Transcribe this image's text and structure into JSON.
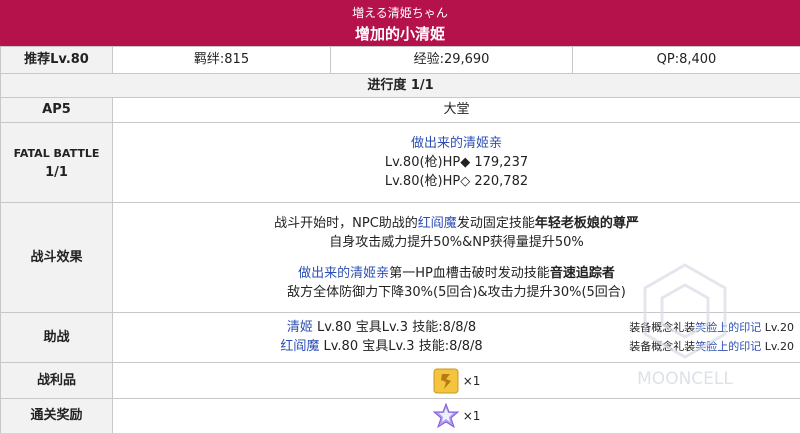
{
  "header": {
    "jp_title": "増える清姫ちゃん",
    "cn_title": "增加的小清姫"
  },
  "stats": {
    "recommend": "推荐Lv.80",
    "bond": "羁绊:815",
    "exp": "经验:29,690",
    "qp": "QP:8,400"
  },
  "progress": "进行度 1/1",
  "ap": {
    "label": "AP5",
    "location": "大堂"
  },
  "battle": {
    "label_line1": "FATAL BATTLE",
    "label_line2": "1/1",
    "enemy_name": "做出来的清姬亲",
    "hp_lines": [
      "Lv.80(枪)HP◆ 179,237",
      "Lv.80(枪)HP◇ 220,782"
    ]
  },
  "effects": {
    "label": "战斗效果",
    "l1_pre": "战斗开始时，NPC助战的",
    "l1_link": "红阎魔",
    "l1_mid": "发动固定技能",
    "l1_bold": "年轻老板娘的尊严",
    "l2": "自身攻击威力提升50%&NP获得量提升50%",
    "l3_link": "做出来的清姬亲",
    "l3_mid": "第一HP血槽击破时发动技能",
    "l3_bold": "音速追踪者",
    "l4": "敌方全体防御力下降30%(5回合)&攻击力提升30%(5回合)"
  },
  "support": {
    "label": "助战",
    "rows": [
      {
        "name": "清姬",
        "info": " Lv.80 宝具Lv.3 技能:8/8/8",
        "ce_pre": "装备概念礼装",
        "ce_link": "笑脸上的印记",
        "ce_lv": " Lv.20"
      },
      {
        "name": "红阎魔",
        "info": " Lv.80 宝具Lv.3 技能:8/8/8",
        "ce_pre": "装备概念礼装",
        "ce_link": "笑脸上的印记",
        "ce_lv": " Lv.20"
      }
    ]
  },
  "drops": {
    "label": "战利品",
    "count": "×1",
    "icon": "gold-monument-icon"
  },
  "reward": {
    "label": "通关奖励",
    "count": "×1",
    "icon": "rainbow-star-quartz-icon"
  },
  "watermark": "MOONCELL",
  "colors": {
    "header_bg": "#b5124b",
    "link": "#2d4fb4",
    "label_bg": "#f2f2f2"
  }
}
